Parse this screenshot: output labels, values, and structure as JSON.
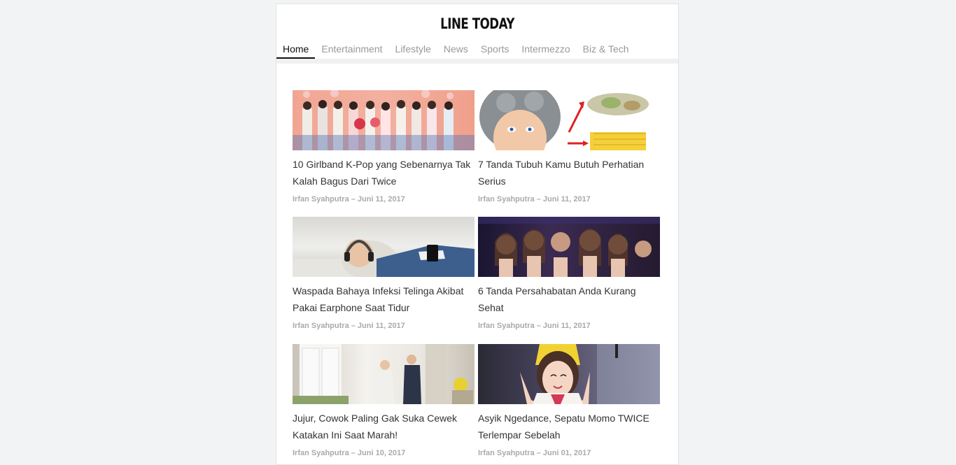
{
  "header": {
    "brand": "LINE TODAY"
  },
  "tabs": [
    {
      "label": "Home",
      "active": true
    },
    {
      "label": "Entertainment",
      "active": false
    },
    {
      "label": "Lifestyle",
      "active": false
    },
    {
      "label": "News",
      "active": false
    },
    {
      "label": "Sports",
      "active": false
    },
    {
      "label": "Intermezzo",
      "active": false
    },
    {
      "label": "Biz & Tech",
      "active": false
    }
  ],
  "articles": [
    {
      "title": "10 Girlband K-Pop yang Sebenarnya Tak Kalah Bagus Dari Twice",
      "meta": "Irfan Syahputra – Juni 11, 2017"
    },
    {
      "title": "7 Tanda Tubuh Kamu Butuh Perhatian Serius",
      "meta": "Irfan Syahputra – Juni 11, 2017"
    },
    {
      "title": "Waspada Bahaya Infeksi Telinga Akibat Pakai Earphone Saat Tidur",
      "meta": "Irfan Syahputra – Juni 11, 2017"
    },
    {
      "title": "6 Tanda Persahabatan Anda Kurang Sehat",
      "meta": "Irfan Syahputra – Juni 11, 2017"
    },
    {
      "title": "Jujur, Cowok Paling Gak Suka Cewek Katakan Ini Saat Marah!",
      "meta": "Irfan Syahputra – Juni 10, 2017"
    },
    {
      "title": "Asyik Ngedance, Sepatu Momo TWICE Terlempar Sebelah",
      "meta": "Irfan Syahputra – Juni 01, 2017"
    }
  ]
}
